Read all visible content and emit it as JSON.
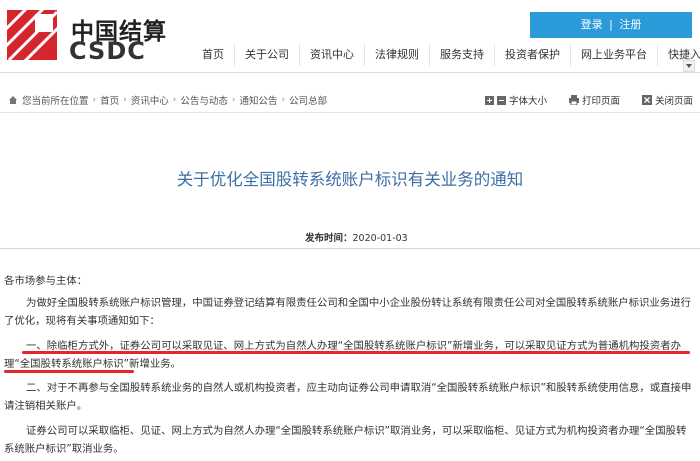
{
  "header": {
    "logo_cn": "中国结算",
    "logo_en": "CSDC",
    "login_label": "登录",
    "register_label": "注册",
    "login_separator": "|"
  },
  "nav": {
    "items": [
      "首页",
      "关于公司",
      "资讯中心",
      "法律规则",
      "服务支持",
      "投资者保护",
      "网上业务平台",
      "快捷入口"
    ]
  },
  "breadcrumb": {
    "prefix": "您当前所在位置",
    "items": [
      "首页",
      "资讯中心",
      "公告与动态",
      "通知公告",
      "公司总部"
    ],
    "separator": "›"
  },
  "tools": {
    "font_size": "字体大小",
    "print": "打印页面",
    "close": "关闭页面"
  },
  "article": {
    "title": "关于优化全国股转系统账户标识有关业务的通知",
    "pub_label": "发布时间：",
    "pub_date": "2020-01-03",
    "p1": "各市场参与主体：",
    "p2": "为做好全国股转系统账户标识管理，中国证券登记结算有限责任公司和全国中小企业股份转让系统有限责任公司对全国股转系统账户标识业务进行了优化，现将有关事项通知如下：",
    "p3": "一、除临柜方式外，证券公司可以采取见证、网上方式为自然人办理“全国股转系统账户标识”新增业务，可以采取见证方式为普通机构投资者办理“全国股转系统账户标识”新增业务。",
    "p4": "二、对于不再参与全国股转系统业务的自然人或机构投资者，应主动向证券公司申请取消“全国股转系统账户标识”和股转系统使用信息，或直接申请注销相关账户。",
    "p5": "证券公司可以采取临柜、见证、网上方式为自然人办理“全国股转系统账户标识”取消业务，可以采取临柜、见证方式为机构投资者办理“全国股转系统账户标识”取消业务。"
  },
  "colors": {
    "accent_blue": "#2b9ad8",
    "title_blue": "#3d6fa5",
    "logo_red": "#d6262d",
    "underline_red": "#e8232a"
  }
}
